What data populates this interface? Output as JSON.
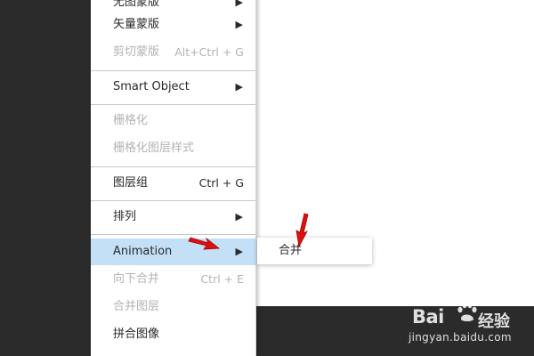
{
  "menu": {
    "items": [
      {
        "label": "无图蒙版",
        "shortcut": "",
        "submenu": true,
        "disabled": false
      },
      {
        "label": "矢量蒙版",
        "shortcut": "",
        "submenu": true,
        "disabled": false
      },
      {
        "label": "剪切蒙版",
        "shortcut": "Alt+Ctrl + G",
        "submenu": false,
        "disabled": true
      },
      {
        "label": "Smart Object",
        "shortcut": "",
        "submenu": true,
        "disabled": false
      },
      {
        "label": "栅格化",
        "shortcut": "",
        "submenu": false,
        "disabled": true
      },
      {
        "label": "栅格化图层样式",
        "shortcut": "",
        "submenu": false,
        "disabled": true
      },
      {
        "label": "图层组",
        "shortcut": "Ctrl + G",
        "submenu": false,
        "disabled": false
      },
      {
        "label": "排列",
        "shortcut": "",
        "submenu": true,
        "disabled": false
      },
      {
        "label": "Animation",
        "shortcut": "",
        "submenu": true,
        "disabled": false,
        "active": true
      },
      {
        "label": "向下合并",
        "shortcut": "Ctrl + E",
        "submenu": false,
        "disabled": true
      },
      {
        "label": "合并图层",
        "shortcut": "",
        "submenu": false,
        "disabled": true
      },
      {
        "label": "拼合图像",
        "shortcut": "",
        "submenu": false,
        "disabled": false
      }
    ],
    "arrow_glyph": "▶"
  },
  "submenu": {
    "items": [
      {
        "label": "合并"
      }
    ]
  },
  "watermark": {
    "brand": "Bai",
    "brand_cn": "经验",
    "url": "jingyan.baidu.com"
  },
  "colors": {
    "active_bg": "#c3e0f7",
    "disabled_text": "#b3b3b3",
    "annotation_arrow": "#e01010"
  }
}
